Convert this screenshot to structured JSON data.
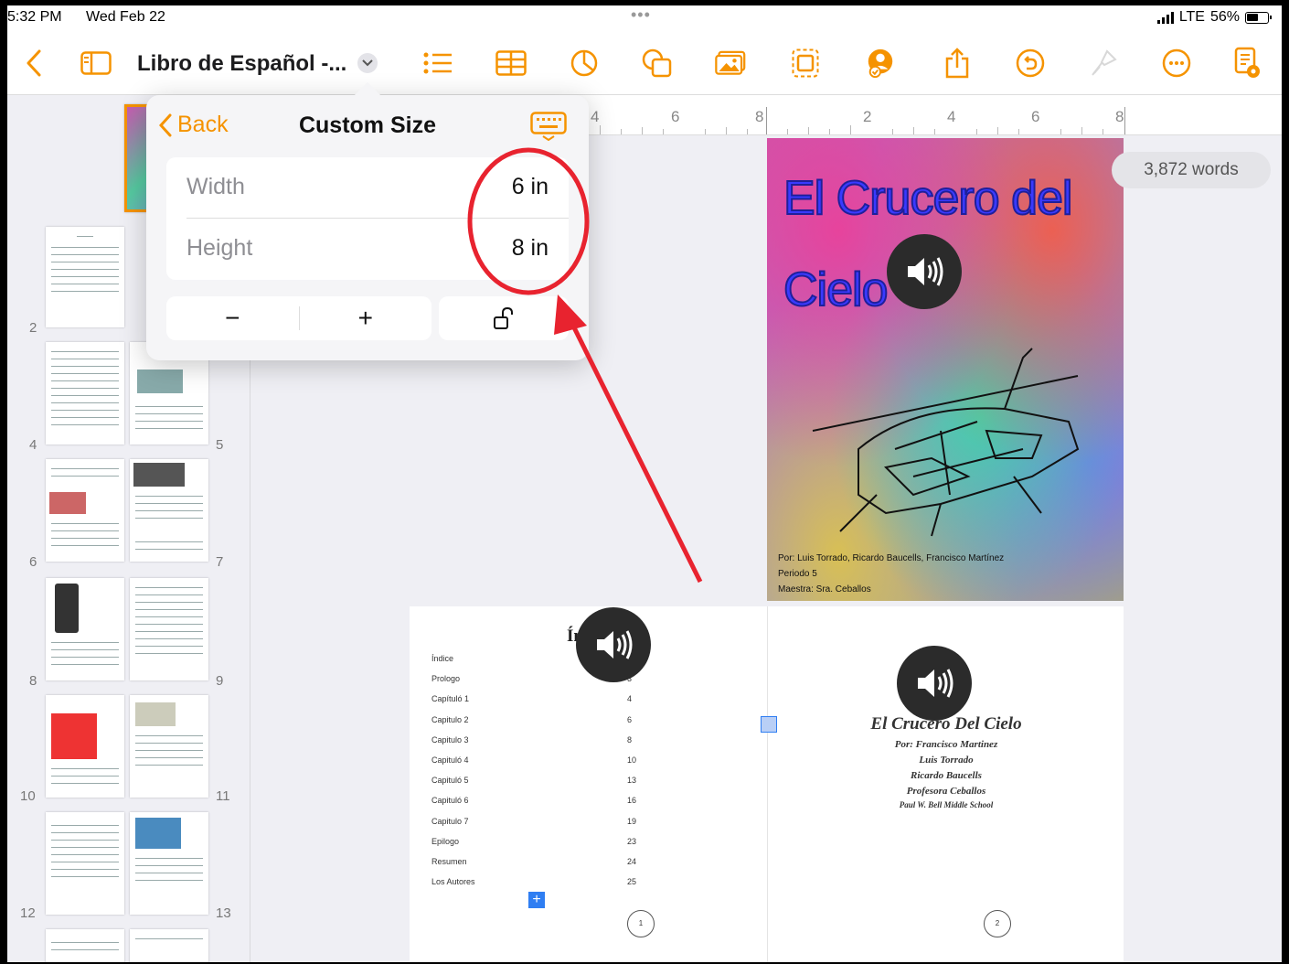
{
  "status_bar": {
    "time": "5:32 PM",
    "date": "Wed Feb 22",
    "carrier": "LTE",
    "battery": "56%"
  },
  "toolbar": {
    "document_title": "Libro de Español -...",
    "icons": [
      "back-chevron-icon",
      "sidebar-toggle-icon",
      "title-dropdown-icon",
      "bulleted-list-icon",
      "table-icon",
      "chart-icon",
      "shapes-icon",
      "media-icon",
      "text-box-icon",
      "collaborate-icon",
      "share-icon",
      "undo-icon",
      "format-brush-icon",
      "more-icon",
      "document-setup-icon"
    ],
    "accent_color": "#f59300"
  },
  "popover": {
    "back_label": "Back",
    "title": "Custom Size",
    "fields": [
      {
        "label": "Width",
        "value": "6 in"
      },
      {
        "label": "Height",
        "value": "8 in"
      }
    ],
    "stepper_minus": "−",
    "stepper_plus": "+"
  },
  "annotation": {
    "highlight_color": "#e8232f"
  },
  "ruler": {
    "labels": [
      "4",
      "6",
      "8",
      "2",
      "4",
      "6",
      "8"
    ]
  },
  "word_count": "3,872 words",
  "thumbnails": {
    "page_numbers": [
      "2",
      "4",
      "5",
      "6",
      "7",
      "8",
      "9",
      "10",
      "11",
      "12",
      "13"
    ]
  },
  "cover": {
    "title_line1": "El Crucero del",
    "title_line2": "Cielo",
    "credits": [
      "Por: Luis Torrado, Ricardo Baucells, Francisco Martínez",
      "Periodo 5",
      "Maestra: Sra. Ceballos"
    ]
  },
  "toc_page": {
    "heading": "Índice",
    "rows": [
      {
        "label": "Índice",
        "num": ""
      },
      {
        "label": "Prologo",
        "num": "3"
      },
      {
        "label": "Capítuló 1",
        "num": "4"
      },
      {
        "label": "Capitulo 2",
        "num": "6"
      },
      {
        "label": "Capitulo 3",
        "num": "8"
      },
      {
        "label": "Capituló 4",
        "num": "10"
      },
      {
        "label": "Capituló 5",
        "num": "13"
      },
      {
        "label": "Capituló 6",
        "num": "16"
      },
      {
        "label": "Capitulo 7",
        "num": "19"
      },
      {
        "label": "Epilogo",
        "num": "23"
      },
      {
        "label": "Resumen",
        "num": "24"
      },
      {
        "label": "Los Autores",
        "num": "25"
      }
    ],
    "page_number": "1"
  },
  "title_page": {
    "title": "El Crucero Del Cielo",
    "lines": [
      "Por: Francisco Martinez",
      "Luis Torrado",
      "Ricardo Baucells",
      "Profesora Ceballos",
      "Paul W. Bell Middle School"
    ],
    "page_number": "2"
  }
}
